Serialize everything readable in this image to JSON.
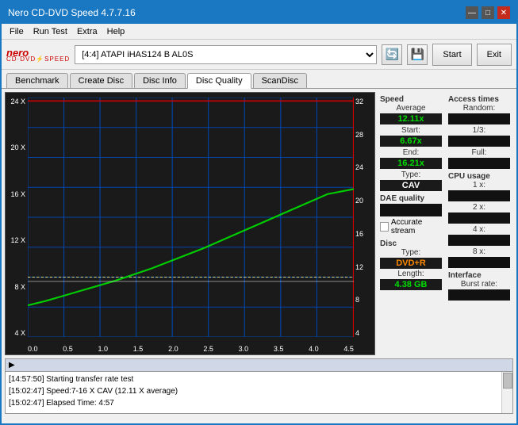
{
  "window": {
    "title": "Nero CD-DVD Speed 4.7.7.16",
    "controls": [
      "minimize",
      "maximize",
      "close"
    ]
  },
  "menu": {
    "items": [
      "File",
      "Run Test",
      "Extra",
      "Help"
    ]
  },
  "toolbar": {
    "drive_value": "[4:4]  ATAPI iHAS124  B AL0S",
    "drive_placeholder": "Select drive",
    "start_label": "Start",
    "exit_label": "Exit"
  },
  "tabs": [
    {
      "label": "Benchmark",
      "active": false
    },
    {
      "label": "Create Disc",
      "active": false
    },
    {
      "label": "Disc Info",
      "active": false
    },
    {
      "label": "Disc Quality",
      "active": true
    },
    {
      "label": "ScanDisc",
      "active": false
    }
  ],
  "chart": {
    "y_left_labels": [
      "24 X",
      "20 X",
      "16 X",
      "12 X",
      "8 X",
      "4 X"
    ],
    "y_right_labels": [
      "32",
      "28",
      "24",
      "20",
      "16",
      "12",
      "8",
      "4"
    ],
    "x_labels": [
      "0.0",
      "0.5",
      "1.0",
      "1.5",
      "2.0",
      "2.5",
      "3.0",
      "3.5",
      "4.0",
      "4.5"
    ]
  },
  "stats": {
    "speed": {
      "label": "Speed",
      "average_label": "Average",
      "average_value": "12.11x",
      "start_label": "Start:",
      "start_value": "6.67x",
      "end_label": "End:",
      "end_value": "16.21x",
      "type_label": "Type:",
      "type_value": "CAV"
    },
    "dae": {
      "label": "DAE quality",
      "value": "",
      "accurate_stream_label": "Accurate stream",
      "accurate_stream_checked": false
    },
    "disc": {
      "label": "Disc",
      "type_label": "Type:",
      "type_value": "DVD+R",
      "length_label": "Length:",
      "length_value": "4.38 GB"
    },
    "access_times": {
      "label": "Access times",
      "random_label": "Random:",
      "random_value": "",
      "one_third_label": "1/3:",
      "one_third_value": "",
      "full_label": "Full:",
      "full_value": ""
    },
    "cpu": {
      "label": "CPU usage",
      "1x_label": "1 x:",
      "1x_value": "",
      "2x_label": "2 x:",
      "2x_value": "",
      "4x_label": "4 x:",
      "4x_value": "",
      "8x_label": "8 x:",
      "8x_value": ""
    },
    "interface": {
      "label": "Interface",
      "burst_label": "Burst rate:",
      "burst_value": ""
    }
  },
  "log": {
    "entries": [
      "[14:57:50]  Starting transfer rate test",
      "[15:02:47]  Speed:7-16 X CAV (12.11 X average)",
      "[15:02:47]  Elapsed Time: 4:57"
    ]
  }
}
